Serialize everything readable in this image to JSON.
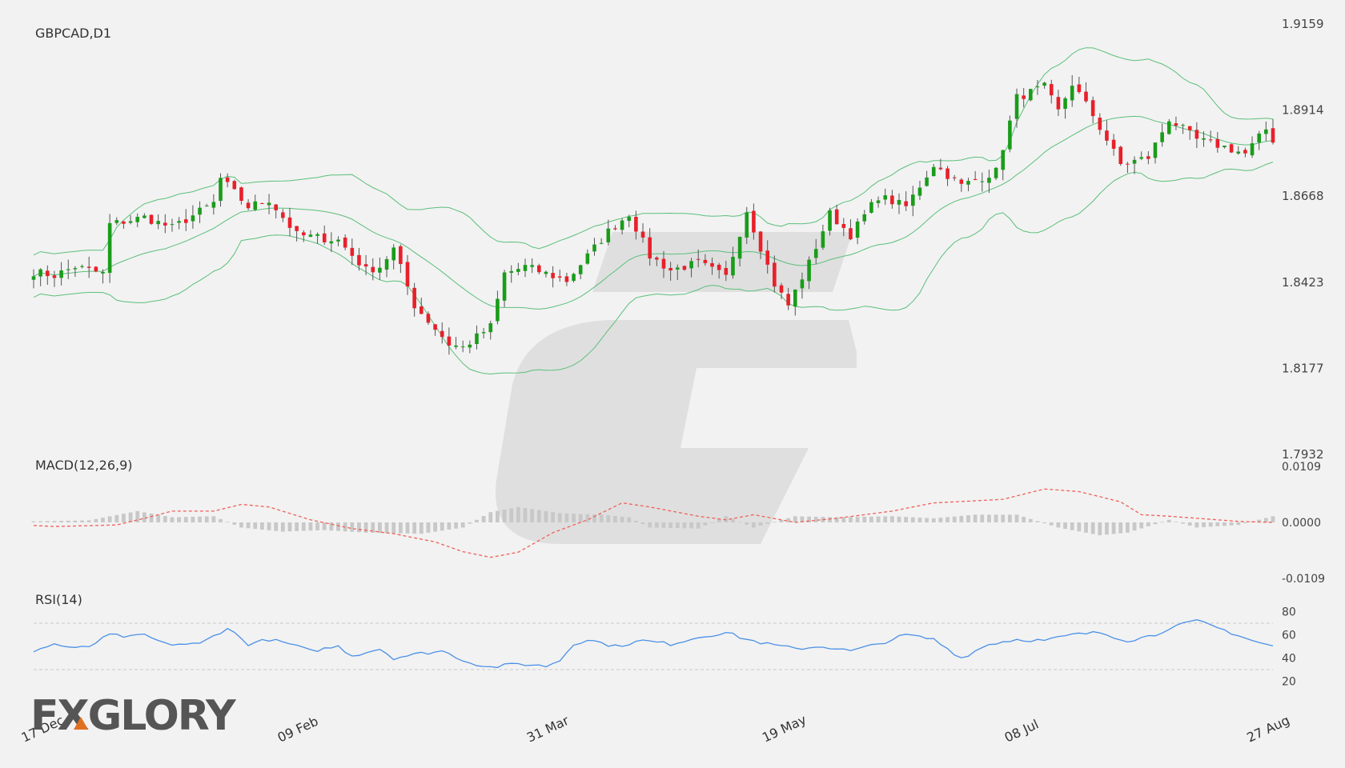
{
  "chart_data": [
    {
      "type": "candlestick",
      "title": "GBPCAD,D1",
      "ylim": [
        1.7932,
        1.9159
      ],
      "y_ticks": [
        "1.9159",
        "1.8914",
        "1.8668",
        "1.8423",
        "1.8177",
        "1.7932"
      ],
      "x_ticks": [
        {
          "label": "17 Dec",
          "index": 0
        },
        {
          "label": "09 Feb",
          "index": 37
        },
        {
          "label": "31 Mar",
          "index": 73
        },
        {
          "label": "19 May",
          "index": 107
        },
        {
          "label": "08 Jul",
          "index": 142
        },
        {
          "label": "27 Aug",
          "index": 177
        }
      ],
      "overlays": [
        {
          "name": "Bollinger Bands",
          "color": "#5bbf7a"
        }
      ],
      "colors": {
        "up": "#1a9c1a",
        "down": "#e8202a",
        "wick": "#555555"
      },
      "close_anchors": [
        [
          0,
          1.8455
        ],
        [
          3,
          1.8445
        ],
        [
          6,
          1.847
        ],
        [
          10,
          1.845
        ],
        [
          11,
          1.859
        ],
        [
          16,
          1.861
        ],
        [
          20,
          1.858
        ],
        [
          26,
          1.865
        ],
        [
          27,
          1.872
        ],
        [
          31,
          1.864
        ],
        [
          34,
          1.866
        ],
        [
          38,
          1.856
        ],
        [
          44,
          1.8545
        ],
        [
          48,
          1.846
        ],
        [
          50,
          1.847
        ],
        [
          52,
          1.852
        ],
        [
          55,
          1.836
        ],
        [
          60,
          1.825
        ],
        [
          62,
          1.824
        ],
        [
          66,
          1.83
        ],
        [
          68,
          1.845
        ],
        [
          71,
          1.847
        ],
        [
          77,
          1.843
        ],
        [
          83,
          1.857
        ],
        [
          86,
          1.862
        ],
        [
          89,
          1.85
        ],
        [
          92,
          1.846
        ],
        [
          96,
          1.848
        ],
        [
          100,
          1.844
        ],
        [
          103,
          1.863
        ],
        [
          107,
          1.842
        ],
        [
          109,
          1.836
        ],
        [
          112,
          1.848
        ],
        [
          115,
          1.862
        ],
        [
          118,
          1.856
        ],
        [
          122,
          1.867
        ],
        [
          126,
          1.864
        ],
        [
          130,
          1.876
        ],
        [
          134,
          1.87
        ],
        [
          139,
          1.874
        ],
        [
          142,
          1.895
        ],
        [
          146,
          1.898
        ],
        [
          148,
          1.891
        ],
        [
          150,
          1.899
        ],
        [
          153,
          1.89
        ],
        [
          157,
          1.876
        ],
        [
          161,
          1.878
        ],
        [
          164,
          1.889
        ],
        [
          168,
          1.883
        ],
        [
          172,
          1.881
        ],
        [
          175,
          1.879
        ],
        [
          178,
          1.886
        ],
        [
          179,
          1.883
        ]
      ]
    },
    {
      "type": "bar+line",
      "title": "MACD(12,26,9)",
      "ylim": [
        -0.0109,
        0.0109
      ],
      "y_ticks": [
        "0.0109",
        "0.0000",
        "-0.0109"
      ],
      "series": [
        {
          "name": "histogram",
          "color": "#c8c8c8"
        },
        {
          "name": "signal",
          "color": "#f0605a"
        }
      ],
      "signal_anchors": [
        [
          0,
          -0.0006
        ],
        [
          3,
          -0.0008
        ],
        [
          12,
          -0.0005
        ],
        [
          16,
          0.0008
        ],
        [
          20,
          0.0022
        ],
        [
          26,
          0.0022
        ],
        [
          30,
          0.0035
        ],
        [
          34,
          0.003
        ],
        [
          40,
          0.0005
        ],
        [
          46,
          -0.0012
        ],
        [
          52,
          -0.0022
        ],
        [
          58,
          -0.0038
        ],
        [
          62,
          -0.0057
        ],
        [
          66,
          -0.0068
        ],
        [
          70,
          -0.0058
        ],
        [
          75,
          -0.002
        ],
        [
          80,
          0.0005
        ],
        [
          85,
          0.0038
        ],
        [
          89,
          0.003
        ],
        [
          96,
          0.0012
        ],
        [
          100,
          0.0005
        ],
        [
          104,
          0.0015
        ],
        [
          110,
          0.0
        ],
        [
          116,
          0.0008
        ],
        [
          124,
          0.0022
        ],
        [
          130,
          0.0038
        ],
        [
          136,
          0.0042
        ],
        [
          140,
          0.0045
        ],
        [
          146,
          0.0065
        ],
        [
          151,
          0.006
        ],
        [
          157,
          0.004
        ],
        [
          160,
          0.0015
        ],
        [
          164,
          0.0012
        ],
        [
          168,
          0.0008
        ],
        [
          174,
          0.0002
        ],
        [
          179,
          0.0
        ]
      ],
      "hist_anchors": [
        [
          0,
          0.0002
        ],
        [
          8,
          0.0004
        ],
        [
          15,
          0.0022
        ],
        [
          20,
          0.001
        ],
        [
          26,
          0.0012
        ],
        [
          30,
          -0.001
        ],
        [
          36,
          -0.0018
        ],
        [
          42,
          -0.0015
        ],
        [
          48,
          -0.002
        ],
        [
          56,
          -0.0022
        ],
        [
          62,
          -0.001
        ],
        [
          66,
          0.002
        ],
        [
          70,
          0.003
        ],
        [
          76,
          0.0018
        ],
        [
          82,
          0.0015
        ],
        [
          86,
          0.001
        ],
        [
          89,
          -0.001
        ],
        [
          96,
          -0.0012
        ],
        [
          100,
          0.0012
        ],
        [
          104,
          -0.001
        ],
        [
          110,
          0.0012
        ],
        [
          116,
          0.001
        ],
        [
          124,
          0.0012
        ],
        [
          130,
          0.0008
        ],
        [
          136,
          0.0015
        ],
        [
          142,
          0.0015
        ],
        [
          148,
          -0.001
        ],
        [
          154,
          -0.0025
        ],
        [
          158,
          -0.002
        ],
        [
          164,
          0.0005
        ],
        [
          168,
          -0.001
        ],
        [
          174,
          -0.0005
        ],
        [
          179,
          0.0012
        ]
      ]
    },
    {
      "type": "line",
      "title": "RSI(14)",
      "ylim": [
        10,
        90
      ],
      "y_ticks": [
        "80",
        "60",
        "40",
        "20"
      ],
      "levels": [
        70,
        30
      ],
      "series": [
        {
          "name": "RSI",
          "color": "#4a90e8"
        }
      ],
      "anchors": [
        [
          0,
          46
        ],
        [
          3,
          52
        ],
        [
          6,
          48
        ],
        [
          8,
          50
        ],
        [
          11,
          60
        ],
        [
          14,
          58
        ],
        [
          16,
          60
        ],
        [
          19,
          52
        ],
        [
          24,
          52
        ],
        [
          28,
          66
        ],
        [
          31,
          52
        ],
        [
          34,
          56
        ],
        [
          37,
          52
        ],
        [
          40,
          46
        ],
        [
          44,
          50
        ],
        [
          46,
          42
        ],
        [
          50,
          48
        ],
        [
          52,
          40
        ],
        [
          56,
          44
        ],
        [
          59,
          46
        ],
        [
          63,
          36
        ],
        [
          66,
          32
        ],
        [
          70,
          35
        ],
        [
          74,
          33
        ],
        [
          76,
          38
        ],
        [
          78,
          52
        ],
        [
          80,
          56
        ],
        [
          84,
          50
        ],
        [
          88,
          55
        ],
        [
          92,
          52
        ],
        [
          96,
          58
        ],
        [
          100,
          62
        ],
        [
          103,
          56
        ],
        [
          106,
          52
        ],
        [
          110,
          48
        ],
        [
          114,
          50
        ],
        [
          118,
          46
        ],
        [
          122,
          52
        ],
        [
          126,
          60
        ],
        [
          130,
          56
        ],
        [
          134,
          40
        ],
        [
          138,
          52
        ],
        [
          142,
          56
        ],
        [
          146,
          55
        ],
        [
          150,
          60
        ],
        [
          154,
          62
        ],
        [
          158,
          55
        ],
        [
          162,
          60
        ],
        [
          164,
          66
        ],
        [
          168,
          72
        ],
        [
          172,
          64
        ],
        [
          176,
          55
        ],
        [
          179,
          50
        ]
      ]
    }
  ],
  "branding": {
    "logo": "FXGLORY"
  }
}
